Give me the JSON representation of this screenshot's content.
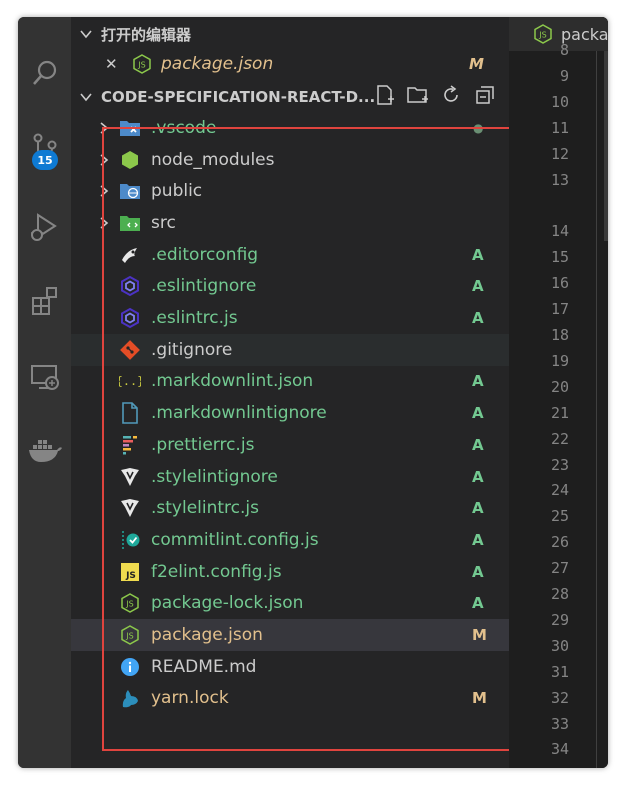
{
  "colors": {
    "added": "#73c991",
    "modified": "#e2c08d",
    "ignored": "#cccccc",
    "default_text": "#cccccc",
    "highlight_box": "#e0443e",
    "badge": "#0e7ad3"
  },
  "activity_bar": {
    "items": [
      {
        "icon": "search-icon"
      },
      {
        "icon": "source-control-icon",
        "badge": "15"
      },
      {
        "icon": "run-debug-icon"
      },
      {
        "icon": "extensions-icon"
      },
      {
        "icon": "remote-explorer-icon"
      },
      {
        "icon": "docker-icon"
      }
    ]
  },
  "open_editors": {
    "title": "打开的编辑器",
    "items": [
      {
        "close_glyph": "✕",
        "icon": "json-icon",
        "name": "package.json",
        "status": "M"
      }
    ]
  },
  "explorer": {
    "title": "CODE-SPECIFICATION-REACT-D...",
    "actions": [
      "new-file-icon",
      "new-folder-icon",
      "refresh-icon",
      "collapse-all-icon"
    ],
    "items": [
      {
        "name": ".vscode",
        "type": "folder",
        "icon": "vscode-folder-icon",
        "status": "●"
      },
      {
        "name": "node_modules",
        "type": "folder",
        "icon": "node-folder-icon",
        "status": ""
      },
      {
        "name": "public",
        "type": "folder",
        "icon": "public-folder-icon",
        "status": ""
      },
      {
        "name": "src",
        "type": "folder",
        "icon": "src-folder-icon",
        "status": ""
      },
      {
        "name": ".editorconfig",
        "type": "file",
        "icon": "editorconfig-icon",
        "status": "A"
      },
      {
        "name": ".eslintignore",
        "type": "file",
        "icon": "eslint-icon",
        "status": "A"
      },
      {
        "name": ".eslintrc.js",
        "type": "file",
        "icon": "eslint-icon",
        "status": "A"
      },
      {
        "name": ".gitignore",
        "type": "file",
        "icon": "git-icon",
        "status": ""
      },
      {
        "name": ".markdownlint.json",
        "type": "file",
        "icon": "json-braces-icon",
        "status": "A"
      },
      {
        "name": ".markdownlintignore",
        "type": "file",
        "icon": "file-icon",
        "status": "A"
      },
      {
        "name": ".prettierrc.js",
        "type": "file",
        "icon": "prettier-icon",
        "status": "A"
      },
      {
        "name": ".stylelintignore",
        "type": "file",
        "icon": "stylelint-icon",
        "status": "A"
      },
      {
        "name": ".stylelintrc.js",
        "type": "file",
        "icon": "stylelint-icon",
        "status": "A"
      },
      {
        "name": "commitlint.config.js",
        "type": "file",
        "icon": "commitlint-icon",
        "status": "A"
      },
      {
        "name": "f2elint.config.js",
        "type": "file",
        "icon": "js-icon",
        "status": "A"
      },
      {
        "name": "package-lock.json",
        "type": "file",
        "icon": "json-icon",
        "status": "A"
      },
      {
        "name": "package.json",
        "type": "file",
        "icon": "json-icon",
        "status": "M"
      },
      {
        "name": "README.md",
        "type": "file",
        "icon": "info-icon",
        "status": ""
      },
      {
        "name": "yarn.lock",
        "type": "file",
        "icon": "yarn-icon",
        "status": "M"
      }
    ]
  },
  "editor": {
    "tab_label": "packa",
    "tab_icon": "json-icon",
    "line_numbers": [
      "8",
      "9",
      "10",
      "11",
      "12",
      "13",
      "14",
      "15",
      "16",
      "17",
      "18",
      "19",
      "20",
      "21",
      "22",
      "23",
      "24",
      "25",
      "26",
      "27",
      "28",
      "29",
      "30",
      "31",
      "32",
      "33",
      "34"
    ]
  }
}
